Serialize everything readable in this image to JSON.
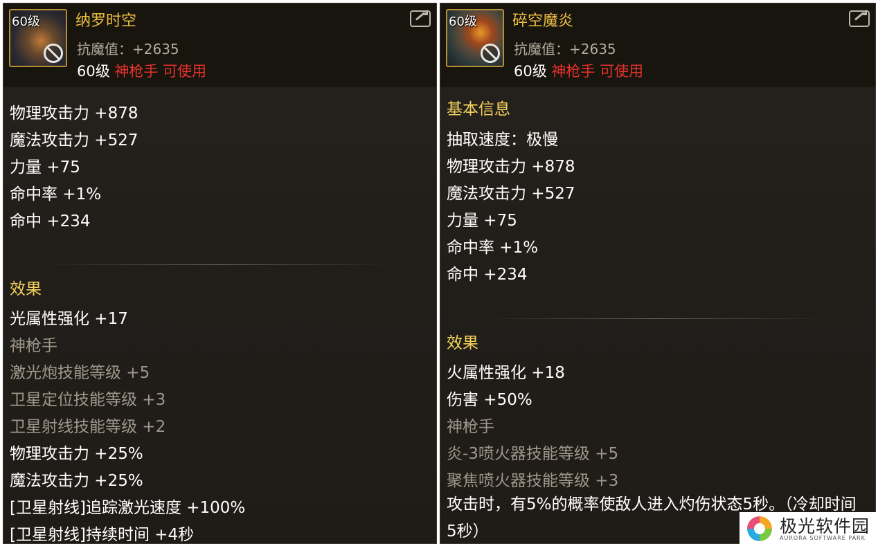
{
  "left_panel": {
    "level_badge": "60级",
    "name": "纳罗时空",
    "magic_resist": "抗魔值：+2635",
    "req_level": "60级",
    "req_class": "神枪手 可使用",
    "stats": [
      "物理攻击力 +878",
      "魔法攻击力 +527",
      "力量 +75",
      "命中率 +1%",
      "命中 +234"
    ],
    "effects_title": "效果",
    "effects": [
      "光属性强化 +17",
      "神枪手",
      "激光炮技能等级 +5",
      "卫星定位技能等级 +3",
      "卫星射线技能等级 +2",
      "物理攻击力 +25%",
      "魔法攻击力 +25%",
      "[卫星射线]追踪激光速度 +100%",
      "[卫星射线]持续时间 +4秒"
    ]
  },
  "right_panel": {
    "level_badge": "60级",
    "name": "碎空魔炎",
    "magic_resist": "抗魔值：+2635",
    "req_level": "60级",
    "req_class": "神枪手 可使用",
    "basic_title": "基本信息",
    "stats": [
      "抽取速度：极慢",
      "物理攻击力 +878",
      "魔法攻击力 +527",
      "力量 +75",
      "命中率 +1%",
      "命中 +234"
    ],
    "effects_title": "效果",
    "effects": [
      "火属性强化 +18",
      "伤害 +50%",
      "神枪手",
      "炎-3喷火器技能等级 +5",
      "聚焦喷火器技能等级 +3"
    ],
    "proc_text": "攻击时，有5%的概率使敌人进入灼伤状态5秒。（冷却时间5秒）"
  },
  "watermark": {
    "title": "极光软件园",
    "subtitle": "AURORA SOFTWARE PARK"
  },
  "colors": {
    "name": "#f0c040",
    "section_title": "#f3d15a",
    "class_red": "#e8312b",
    "muted": "#9e968a"
  }
}
